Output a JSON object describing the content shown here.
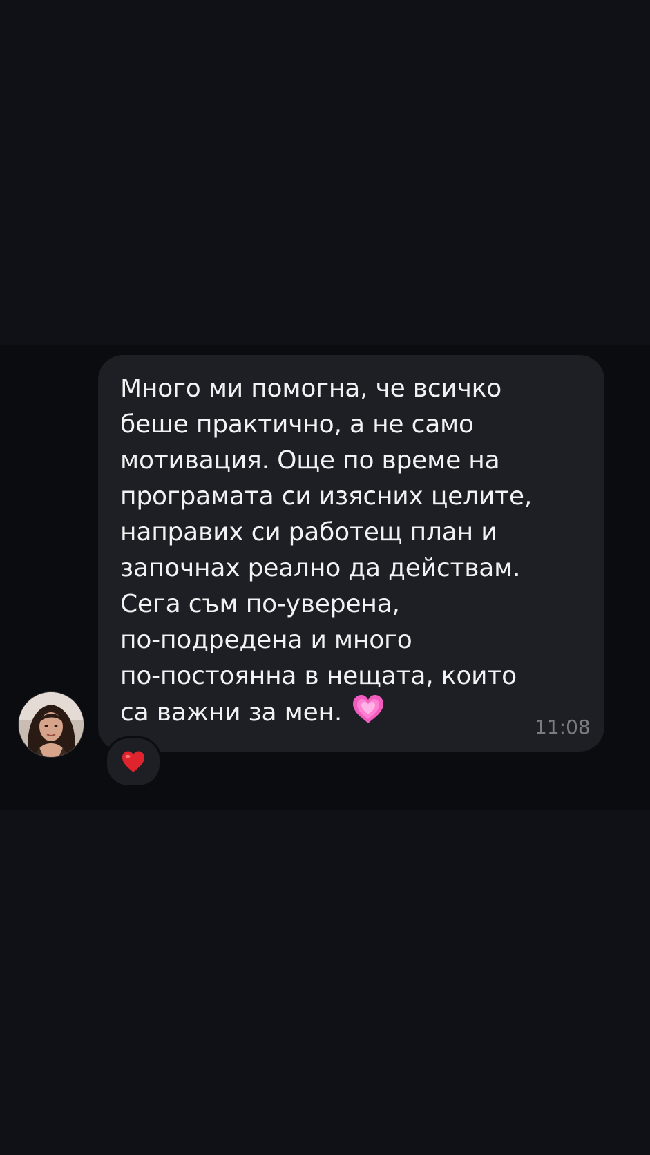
{
  "message": {
    "lines": [
      "Много ми помогна, че всичко",
      "беше практично, а не само",
      "мотивация. Още по време на",
      "програмата си изясних целите,",
      "направих си работещ план и",
      "започнах реално да действам.",
      "Сега съм по-уверена,",
      "по-подредена и много",
      "по-постоянна в нещата, които",
      "са важни за мен."
    ],
    "inline_emoji": "growing-heart-icon",
    "time": "11:08"
  },
  "sender": {
    "avatar": "profile-photo"
  },
  "reaction": {
    "emoji": "red-heart-icon"
  },
  "colors": {
    "background": "#101116",
    "band": "#0b0c10",
    "bubble": "#1e1f24",
    "text": "#f2f2f4",
    "time": "#7b7c82",
    "pink_heart": "#f25cc0",
    "red_heart": "#e0242e"
  }
}
